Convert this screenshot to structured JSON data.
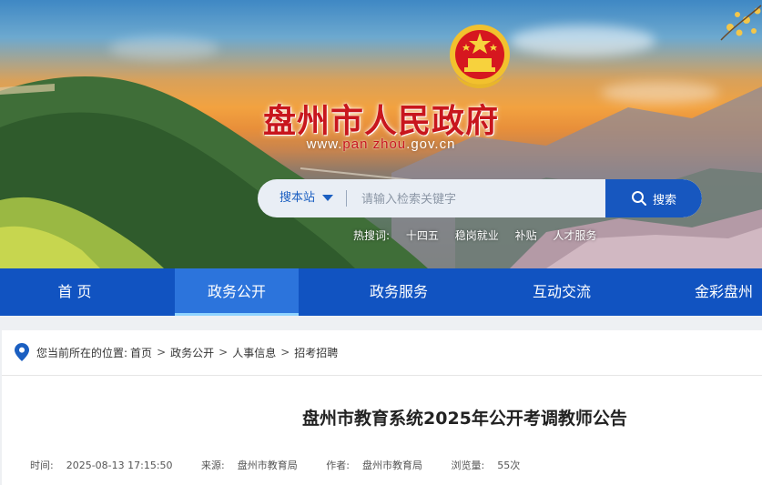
{
  "header": {
    "site_title": "盘州市人民政府",
    "url_prefix": "www.",
    "url_mid": "pan zhou",
    "url_suffix": ".gov.cn",
    "emblem_icon": "national-emblem-icon"
  },
  "search": {
    "scope_label": "搜本站",
    "placeholder": "请输入检索关键字",
    "button_label": "搜索",
    "hot_label": "热搜词:",
    "hot_terms": [
      "十四五",
      "稳岗就业",
      "补贴",
      "人才服务"
    ]
  },
  "nav": {
    "items": [
      "首 页",
      "政务公开",
      "政务服务",
      "互动交流",
      "金彩盘州"
    ],
    "active_index": 1
  },
  "breadcrumb": {
    "prefix": "您当前所在的位置:",
    "items": [
      "首页",
      "政务公开",
      "人事信息",
      "招考招聘"
    ],
    "separator": ">"
  },
  "article": {
    "title": "盘州市教育系统2025年公开考调教师公告",
    "time_label": "时间:",
    "time": "2025-08-13 17:15:50",
    "source_label": "来源:",
    "source": "盘州市教育局",
    "author_label": "作者:",
    "author": "盘州市教育局",
    "views_label": "浏览量:",
    "views": "55次"
  },
  "colors": {
    "nav_bg": "#1153c1",
    "nav_active": "#2c74dc",
    "title_red": "#c8161d",
    "search_button": "#1757bf"
  }
}
